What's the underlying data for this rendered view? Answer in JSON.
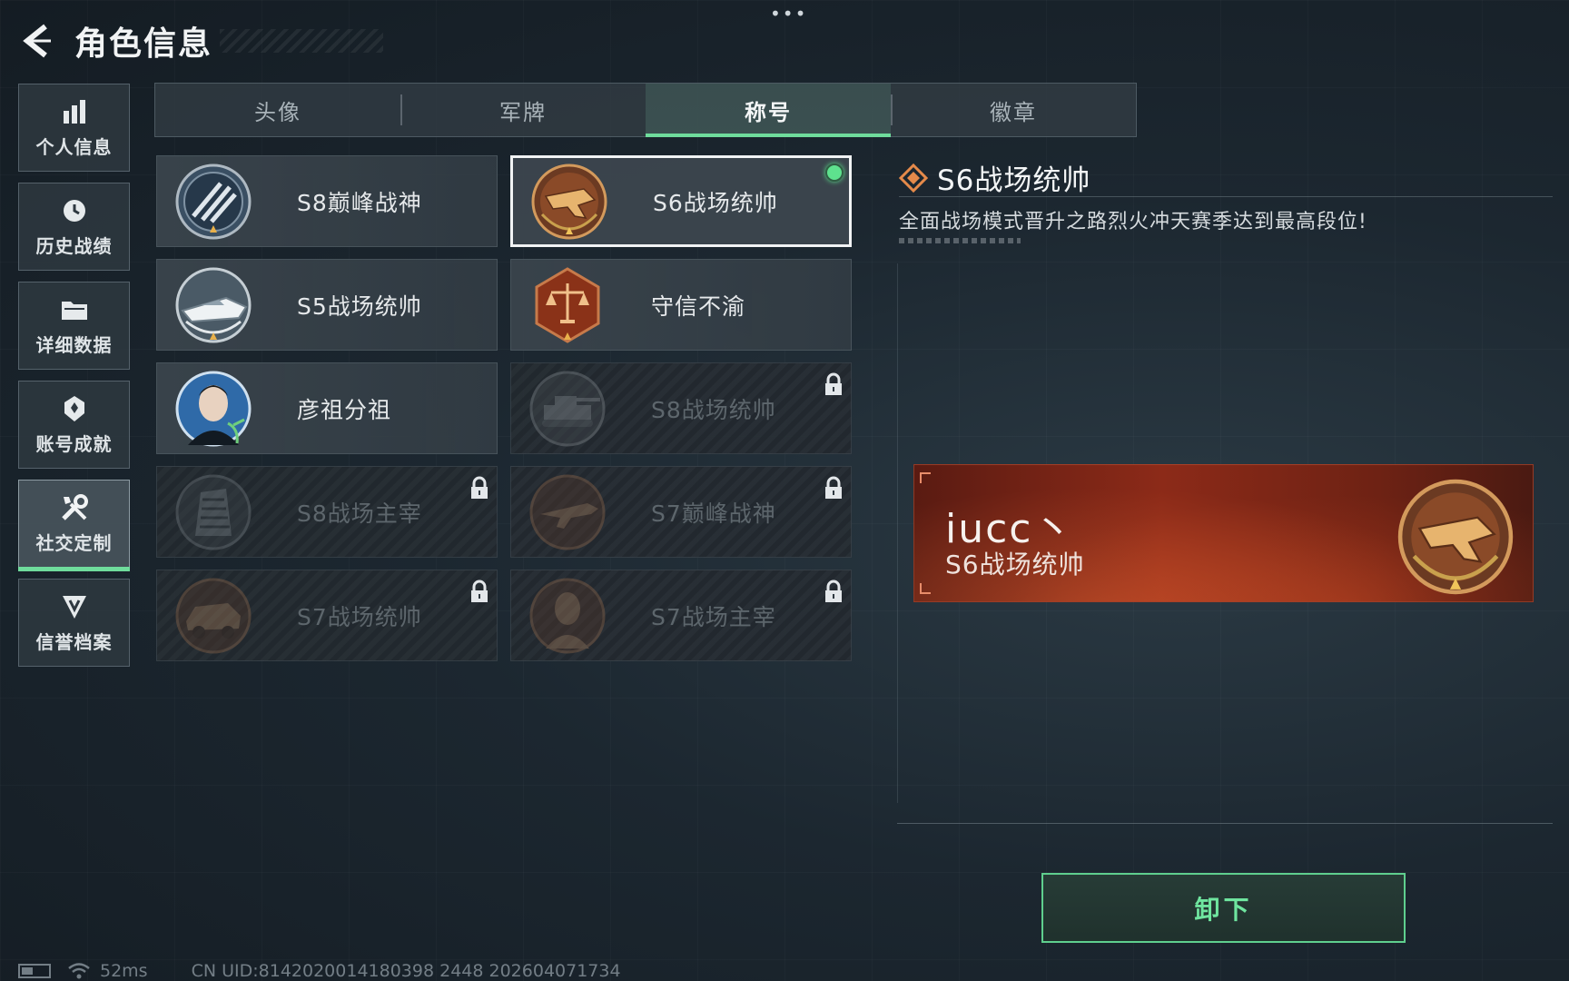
{
  "page": {
    "title": "角色信息",
    "menu_dots": "•••"
  },
  "sidebar": {
    "items": [
      {
        "label": "个人信息",
        "icon": "bar-chart-icon",
        "active": false
      },
      {
        "label": "历史战绩",
        "icon": "history-clock-icon",
        "active": false
      },
      {
        "label": "详细数据",
        "icon": "folder-icon",
        "active": false
      },
      {
        "label": "账号成就",
        "icon": "achievement-icon",
        "active": false
      },
      {
        "label": "社交定制",
        "icon": "tools-icon",
        "active": true
      },
      {
        "label": "信誉档案",
        "icon": "shield-emblem-icon",
        "active": false
      }
    ]
  },
  "tabs": [
    {
      "label": "头像",
      "active": false
    },
    {
      "label": "军牌",
      "active": false
    },
    {
      "label": "称号",
      "active": true
    },
    {
      "label": "徽章",
      "active": false
    }
  ],
  "titles": [
    {
      "label": "S8巅峰战神",
      "locked": false,
      "selected": false,
      "badge": "wings-emblem-icon"
    },
    {
      "label": "S6战场统帅",
      "locked": false,
      "selected": true,
      "equipped": true,
      "badge": "jet-fighter-badge-icon"
    },
    {
      "label": "S5战场统帅",
      "locked": false,
      "selected": false,
      "badge": "speedboat-badge-icon"
    },
    {
      "label": "守信不渝",
      "locked": false,
      "selected": false,
      "badge": "scales-badge-icon"
    },
    {
      "label": "彦祖分祖",
      "locked": false,
      "selected": false,
      "badge": "portrait-avatar-icon"
    },
    {
      "label": "S8战场统帅",
      "locked": true,
      "selected": false,
      "badge": "tank-badge-icon"
    },
    {
      "label": "S8战场主宰",
      "locked": true,
      "selected": false,
      "badge": "building-badge-icon"
    },
    {
      "label": "S7巅峰战神",
      "locked": true,
      "selected": false,
      "badge": "rifle-badge-icon"
    },
    {
      "label": "S7战场统帅",
      "locked": true,
      "selected": false,
      "badge": "vehicle-badge-icon"
    },
    {
      "label": "S7战场主宰",
      "locked": true,
      "selected": false,
      "badge": "soldier-badge-icon"
    }
  ],
  "detail": {
    "title": "S6战场统帅",
    "description": "全面战场模式晋升之路烈火冲天赛季达到最高段位!",
    "nameplate": {
      "player_name": "iucc丶",
      "title": "S6战场统帅"
    },
    "action_label": "卸下"
  },
  "footer": {
    "ping": "52ms",
    "uid_text": "CN UID:8142020014180398 2448 202604071734"
  },
  "colors": {
    "accent_green": "#6fdc9c",
    "nameplate_red": "#8c2a18",
    "badge_bronze": "#b0683a"
  }
}
